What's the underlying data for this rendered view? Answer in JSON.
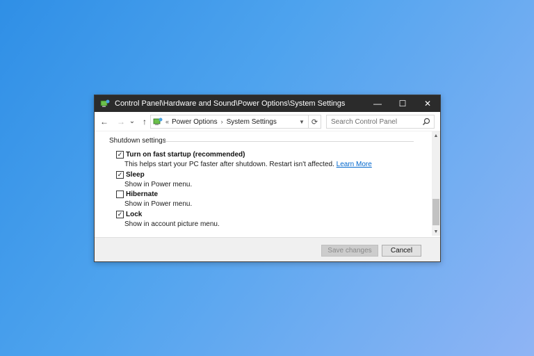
{
  "window": {
    "title": "Control Panel\\Hardware and Sound\\Power Options\\System Settings",
    "controls": {
      "minimize": "—",
      "maximize": "☐",
      "close": "✕"
    }
  },
  "nav": {
    "back": "←",
    "forward": "→",
    "recent": "⌄",
    "up": "↑",
    "path_prefix": "«",
    "breadcrumb": [
      "Power Options",
      "System Settings"
    ],
    "separator": "›",
    "refresh": "⟳"
  },
  "search": {
    "placeholder": "Search Control Panel"
  },
  "shutdown": {
    "heading": "Shutdown settings",
    "options": [
      {
        "label": "Turn on fast startup (recommended)",
        "checked": true,
        "desc": "This helps start your PC faster after shutdown. Restart isn't affected.",
        "link": "Learn More"
      },
      {
        "label": "Sleep",
        "checked": true,
        "desc": "Show in Power menu."
      },
      {
        "label": "Hibernate",
        "checked": false,
        "desc": "Show in Power menu."
      },
      {
        "label": "Lock",
        "checked": true,
        "desc": "Show in account picture menu."
      }
    ]
  },
  "buttons": {
    "save": "Save changes",
    "cancel": "Cancel"
  },
  "colors": {
    "background": "#3a97e8",
    "titlebar": "#2b2b2b",
    "link": "#0066cc"
  }
}
